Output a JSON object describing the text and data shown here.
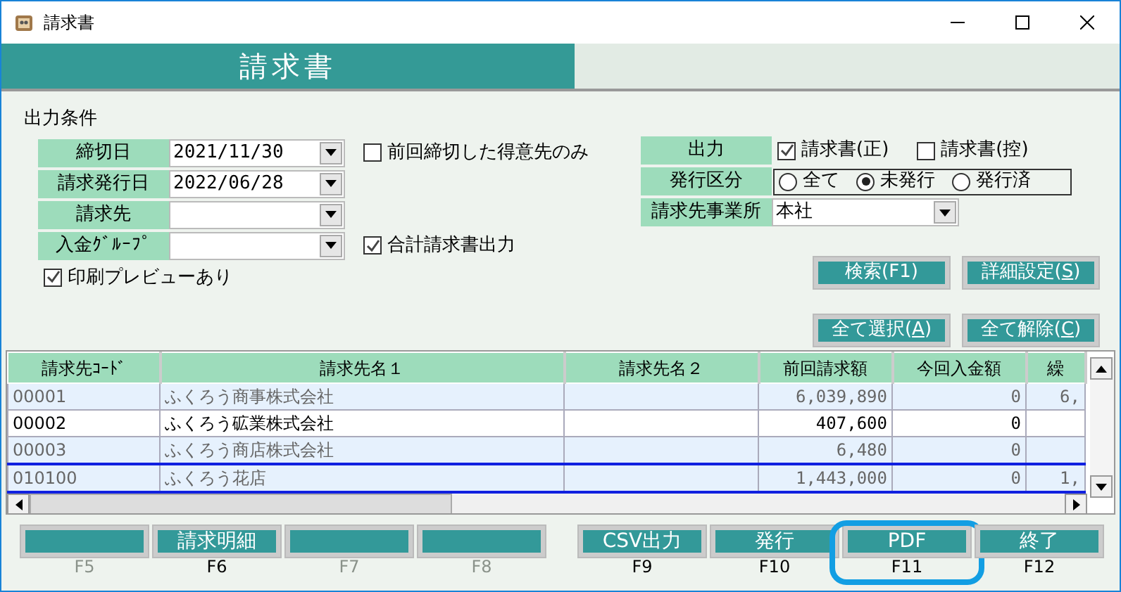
{
  "window": {
    "title": "請求書"
  },
  "header": {
    "title": "請求書"
  },
  "conditions": {
    "title": "出力条件",
    "fields": [
      {
        "label": "締切日",
        "value": "2021/11/30",
        "check": {
          "label": "前回締切した得意先のみ",
          "checked": false
        }
      },
      {
        "label": "請求発行日",
        "value": "2022/06/28"
      },
      {
        "label": "請求先"
      },
      {
        "label": "入金ｸﾞﾙｰﾌﾟ",
        "check": {
          "label": "合計請求書出力",
          "checked": true
        }
      }
    ],
    "preview": {
      "label": "印刷プレビューあり",
      "checked": true
    },
    "output": {
      "label": "出力",
      "options": [
        {
          "label": "請求書(正)",
          "checked": true
        },
        {
          "label": "請求書(控)",
          "checked": false
        }
      ]
    },
    "issue_type": {
      "label": "発行区分",
      "options": [
        {
          "label": "全て",
          "selected": false
        },
        {
          "label": "未発行",
          "selected": true
        },
        {
          "label": "発行済",
          "selected": false
        }
      ]
    },
    "office": {
      "label": "請求先事業所",
      "value": "本社"
    }
  },
  "button_rows": [
    [
      {
        "label": "検索(F1)"
      },
      {
        "label": "詳細設定(",
        "accesskey": "S",
        "suffix": ")"
      }
    ],
    [
      {
        "label": "全て選択(",
        "accesskey": "A",
        "suffix": ")"
      },
      {
        "label": "全て解除(",
        "accesskey": "C",
        "suffix": ")"
      }
    ]
  ],
  "table": {
    "columns": [
      "請求先ｺｰﾄﾞ",
      "請求先名１",
      "請求先名２",
      "前回請求額",
      "今回入金額",
      "繰"
    ],
    "rows": [
      {
        "cells": [
          "00001",
          "ふくろう商事株式会社",
          "",
          "6,039,890",
          "0",
          "6,"
        ],
        "selected": false,
        "focused": false
      },
      {
        "cells": [
          "00002",
          "ふくろう砿業株式会社",
          "",
          "407,600",
          "0",
          ""
        ],
        "selected": true,
        "focused": false
      },
      {
        "cells": [
          "00003",
          "ふくろう商店株式会社",
          "",
          "6,480",
          "0",
          ""
        ],
        "selected": false,
        "focused": false
      },
      {
        "cells": [
          "010100",
          "ふくろう花店",
          "",
          "1,443,000",
          "0",
          "1,"
        ],
        "selected": false,
        "focused": true
      }
    ]
  },
  "function_keys": [
    {
      "key": "F5",
      "enabled": false
    },
    {
      "label": "請求明細",
      "key": "F6",
      "enabled": true
    },
    {
      "key": "F7",
      "enabled": false
    },
    {
      "key": "F8",
      "enabled": false
    },
    {
      "label": "CSV出力",
      "key": "F9",
      "enabled": true
    },
    {
      "label": "発行",
      "key": "F10",
      "enabled": true
    },
    {
      "label": "PDF",
      "key": "F11",
      "enabled": true,
      "highlighted": true
    },
    {
      "label": "終了",
      "key": "F12",
      "enabled": true
    }
  ]
}
